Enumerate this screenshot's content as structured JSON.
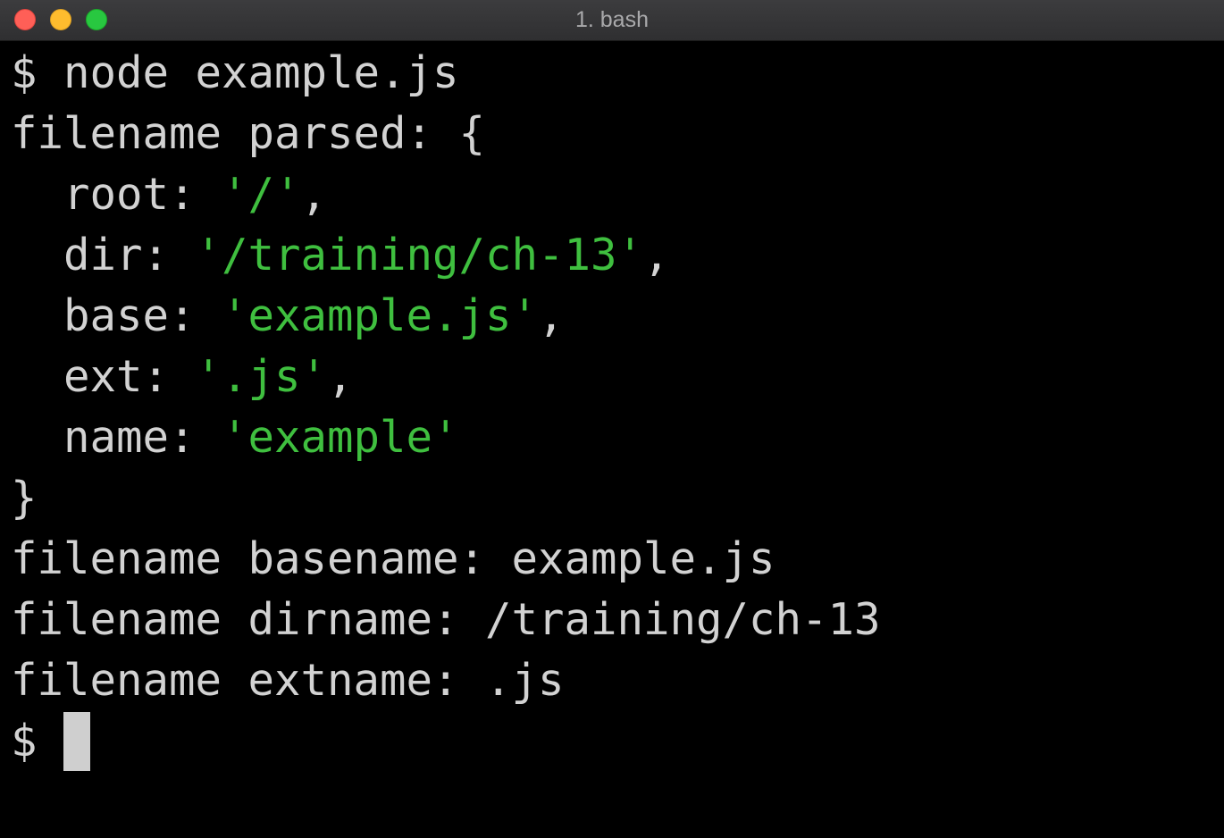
{
  "window": {
    "title": "1. bash"
  },
  "terminal": {
    "lines": [
      {
        "prompt": "$",
        "command": "node example.js"
      },
      {
        "text": "filename parsed: {"
      },
      {
        "indent": "  ",
        "key": "root: ",
        "value": "'/'",
        "suffix": ","
      },
      {
        "indent": "  ",
        "key": "dir: ",
        "value": "'/training/ch-13'",
        "suffix": ","
      },
      {
        "indent": "  ",
        "key": "base: ",
        "value": "'example.js'",
        "suffix": ","
      },
      {
        "indent": "  ",
        "key": "ext: ",
        "value": "'.js'",
        "suffix": ","
      },
      {
        "indent": "  ",
        "key": "name: ",
        "value": "'example'",
        "suffix": ""
      },
      {
        "text": "}"
      },
      {
        "text": "filename basename: example.js"
      },
      {
        "text": "filename dirname: /training/ch-13"
      },
      {
        "text": "filename extname: .js"
      },
      {
        "prompt": "$"
      }
    ]
  },
  "colors": {
    "background": "#000000",
    "text": "#d2d2d2",
    "string": "#3fbf3f",
    "cursor": "#cfcfcf"
  }
}
